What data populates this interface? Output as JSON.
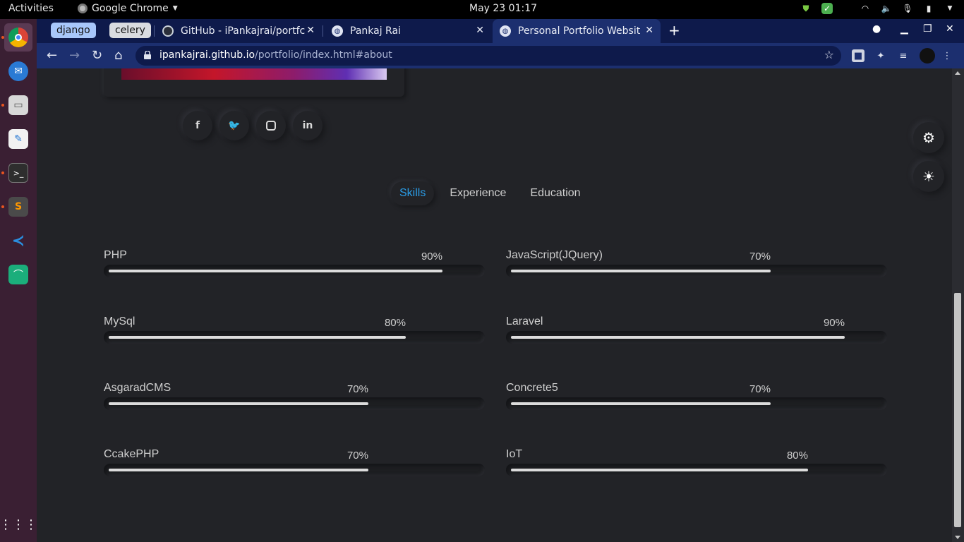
{
  "system": {
    "activities": "Activities",
    "app_name": "Google Chrome",
    "clock": "May 23  01:17"
  },
  "browser": {
    "tab_groups": [
      {
        "label": "django",
        "color": "#a8c7fa"
      },
      {
        "label": "celery",
        "color": "#dadce0"
      }
    ],
    "tabs": [
      {
        "title": "GitHub - iPankajrai/portfc",
        "active": false
      },
      {
        "title": "Pankaj Rai",
        "active": false
      },
      {
        "title": "Personal Portfolio Websit",
        "active": true
      }
    ],
    "url_host": "ipankajrai.github.io",
    "url_path": "/portfolio/index.html#about"
  },
  "page": {
    "social_icons": [
      "facebook-icon",
      "twitter-icon",
      "instagram-icon",
      "linkedin-icon"
    ],
    "section_tabs": [
      {
        "label": "Skills",
        "active": true
      },
      {
        "label": "Experience",
        "active": false
      },
      {
        "label": "Education",
        "active": false
      }
    ],
    "accent_color": "#2a9de8",
    "skills": [
      {
        "name": "PHP",
        "percent": "90%",
        "level": 0.9
      },
      {
        "name": "JavaScript(JQuery)",
        "percent": "70%",
        "level": 0.7
      },
      {
        "name": "MySql",
        "percent": "80%",
        "level": 0.8
      },
      {
        "name": "Laravel",
        "percent": "90%",
        "level": 0.9
      },
      {
        "name": "AsgaradCMS",
        "percent": "70%",
        "level": 0.7
      },
      {
        "name": "Concrete5",
        "percent": "70%",
        "level": 0.7
      },
      {
        "name": "CcakePHP",
        "percent": "70%",
        "level": 0.7
      },
      {
        "name": "IoT",
        "percent": "80%",
        "level": 0.8
      }
    ]
  }
}
